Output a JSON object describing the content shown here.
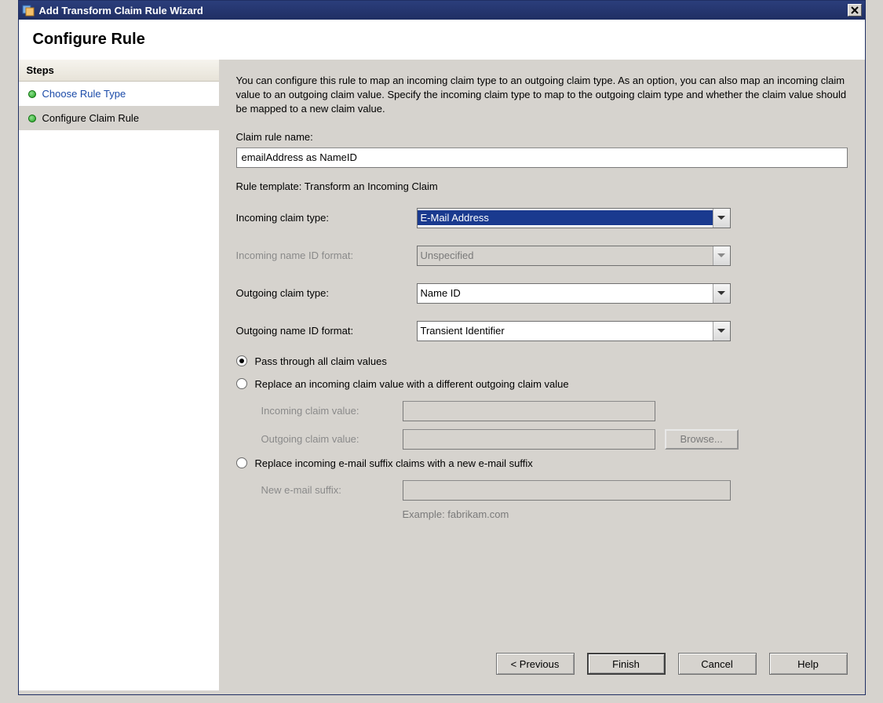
{
  "window": {
    "title": "Add Transform Claim Rule Wizard"
  },
  "header": {
    "title": "Configure Rule"
  },
  "sidebar": {
    "title": "Steps",
    "items": [
      {
        "label": "Choose Rule Type"
      },
      {
        "label": "Configure Claim Rule"
      }
    ]
  },
  "main": {
    "description": "You can configure this rule to map an incoming claim type to an outgoing claim type. As an option, you can also map an incoming claim value to an outgoing claim value. Specify the incoming claim type to map to the outgoing claim type and whether the claim value should be mapped to a new claim value.",
    "claim_rule_name_label": "Claim rule name:",
    "claim_rule_name_value": "emailAddress as NameID",
    "rule_template_label": "Rule template: Transform an Incoming Claim",
    "incoming_claim_type_label": "Incoming claim type:",
    "incoming_claim_type_value": "E-Mail Address",
    "incoming_name_id_label": "Incoming name ID format:",
    "incoming_name_id_value": "Unspecified",
    "outgoing_claim_type_label": "Outgoing claim type:",
    "outgoing_claim_type_value": "Name ID",
    "outgoing_name_id_label": "Outgoing name ID format:",
    "outgoing_name_id_value": "Transient Identifier",
    "radios": {
      "pass_through": "Pass through all claim values",
      "replace_value": "Replace an incoming claim value with a different outgoing claim value",
      "replace_suffix": "Replace incoming e-mail suffix claims with a new e-mail suffix"
    },
    "incoming_claim_value_label": "Incoming claim value:",
    "outgoing_claim_value_label": "Outgoing claim value:",
    "browse_label": "Browse...",
    "new_email_suffix_label": "New e-mail suffix:",
    "example_label": "Example: fabrikam.com"
  },
  "buttons": {
    "previous": "< Previous",
    "finish": "Finish",
    "cancel": "Cancel",
    "help": "Help"
  }
}
